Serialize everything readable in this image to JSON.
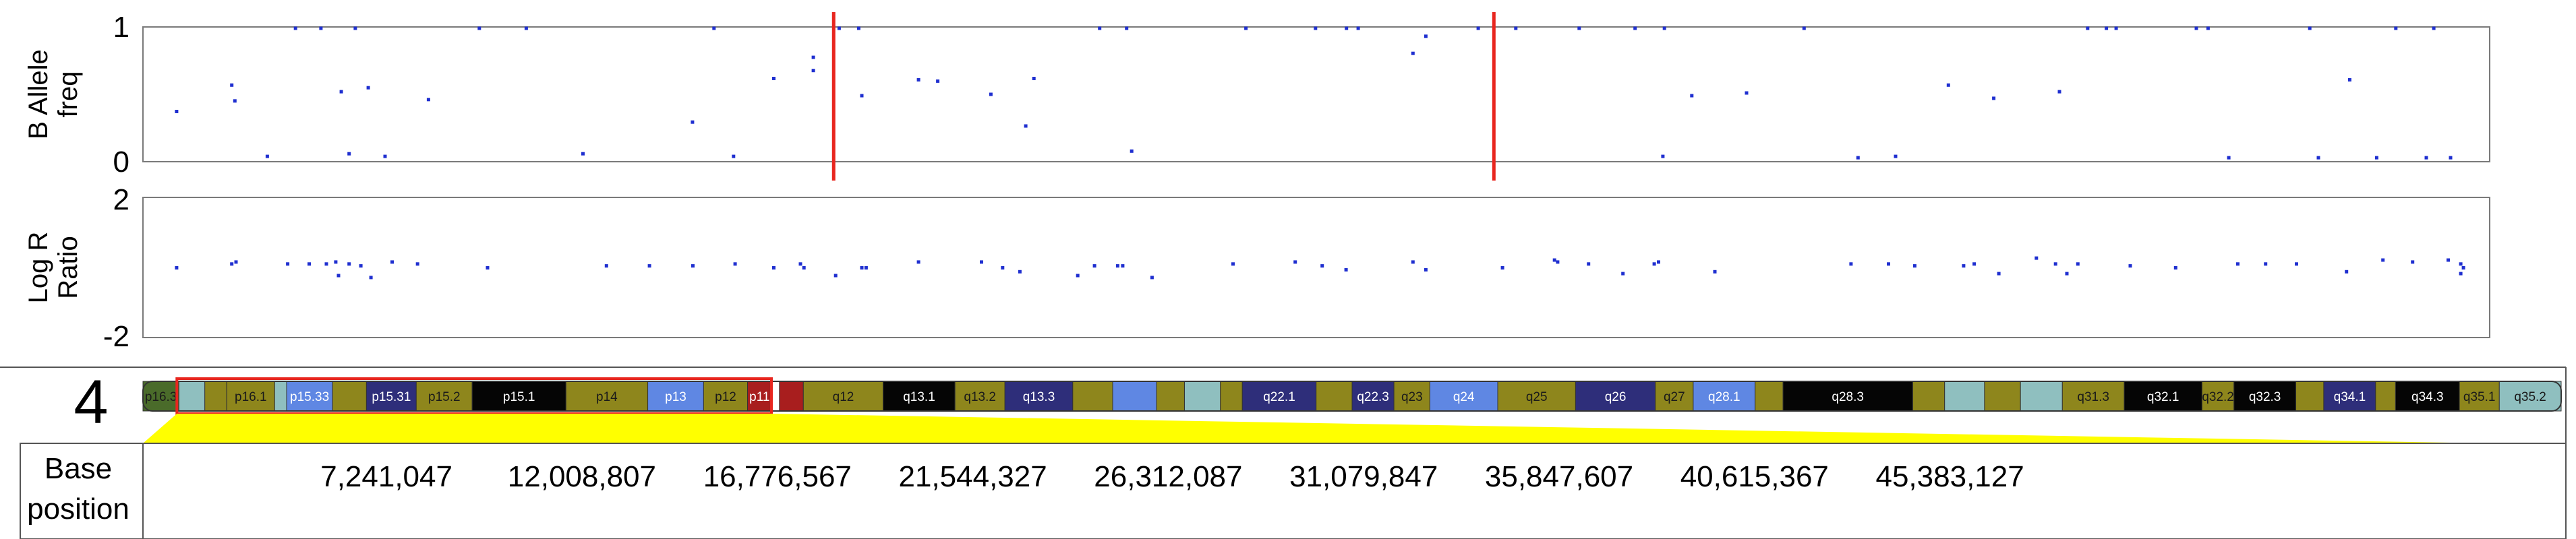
{
  "chart_data": [
    {
      "type": "scatter",
      "ylabel": "B Allele freq",
      "ylim": [
        0,
        1
      ],
      "yticks": [
        "1",
        "0"
      ],
      "point_color": "#1f2fd0",
      "marker_color": "#e8261f",
      "markers_mb": [
        17.66,
        34.54
      ],
      "points": [
        [
          0.86,
          0.37
        ],
        [
          2.27,
          0.57
        ],
        [
          2.35,
          0.45
        ],
        [
          3.18,
          0.03
        ],
        [
          5.07,
          0.52
        ],
        [
          5.27,
          0.05
        ],
        [
          5.76,
          0.55
        ],
        [
          6.19,
          0.03
        ],
        [
          7.3,
          0.46
        ],
        [
          11.25,
          0.05
        ],
        [
          14.05,
          0.29
        ],
        [
          15.1,
          0.03
        ],
        [
          16.13,
          0.62
        ],
        [
          17.14,
          0.68
        ],
        [
          17.14,
          0.78
        ],
        [
          18.38,
          0.49
        ],
        [
          19.83,
          0.61
        ],
        [
          20.32,
          0.6
        ],
        [
          21.68,
          0.5
        ],
        [
          22.57,
          0.26
        ],
        [
          22.78,
          0.62
        ],
        [
          25.28,
          0.07
        ],
        [
          3.9,
          1.0
        ],
        [
          4.55,
          1.0
        ],
        [
          5.43,
          1.0
        ],
        [
          8.6,
          1.0
        ],
        [
          9.8,
          1.0
        ],
        [
          14.6,
          1.0
        ],
        [
          17.8,
          1.0
        ],
        [
          18.3,
          1.0
        ],
        [
          24.46,
          1.0
        ],
        [
          25.15,
          1.0
        ],
        [
          28.2,
          1.0
        ],
        [
          29.98,
          1.0
        ],
        [
          30.77,
          1.0
        ],
        [
          31.07,
          1.0
        ],
        [
          32.47,
          0.81
        ],
        [
          32.8,
          0.94
        ],
        [
          34.14,
          1.0
        ],
        [
          35.1,
          1.0
        ],
        [
          36.72,
          1.0
        ],
        [
          38.15,
          1.0
        ],
        [
          38.86,
          0.03
        ],
        [
          38.9,
          1.0
        ],
        [
          39.6,
          0.49
        ],
        [
          41.0,
          0.51
        ],
        [
          42.47,
          1.0
        ],
        [
          43.85,
          0.02
        ],
        [
          44.81,
          0.03
        ],
        [
          46.16,
          0.57
        ],
        [
          47.32,
          0.47
        ],
        [
          49.0,
          0.52
        ],
        [
          49.72,
          1.0
        ],
        [
          50.2,
          1.0
        ],
        [
          50.45,
          1.0
        ],
        [
          52.5,
          1.0
        ],
        [
          53.33,
          0.02
        ],
        [
          55.4,
          1.0
        ],
        [
          56.42,
          0.61
        ],
        [
          57.11,
          0.02
        ],
        [
          57.6,
          1.0
        ],
        [
          58.38,
          0.02
        ],
        [
          58.57,
          1.0
        ],
        [
          59.0,
          0.02
        ],
        [
          52.8,
          1.0
        ],
        [
          55.62,
          0.02
        ]
      ]
    },
    {
      "type": "scatter",
      "ylabel": "Log R Ratio",
      "ylim": [
        -2,
        2
      ],
      "yticks": [
        "2",
        "-2"
      ],
      "point_color": "#1f2fd0",
      "points": [
        [
          0.86,
          0.0
        ],
        [
          2.27,
          0.2
        ],
        [
          2.38,
          0.3
        ],
        [
          3.7,
          0.2
        ],
        [
          4.25,
          0.2
        ],
        [
          4.69,
          0.2
        ],
        [
          4.93,
          0.3
        ],
        [
          5.0,
          -0.4
        ],
        [
          5.27,
          0.2
        ],
        [
          5.57,
          0.1
        ],
        [
          5.83,
          -0.5
        ],
        [
          6.37,
          0.3
        ],
        [
          7.02,
          0.2
        ],
        [
          8.81,
          0.0
        ],
        [
          11.85,
          0.1
        ],
        [
          12.95,
          0.1
        ],
        [
          14.06,
          0.1
        ],
        [
          15.14,
          0.2
        ],
        [
          16.13,
          0.0
        ],
        [
          16.81,
          0.2
        ],
        [
          16.9,
          0.0
        ],
        [
          17.71,
          -0.4
        ],
        [
          18.38,
          0.0
        ],
        [
          18.49,
          0.0
        ],
        [
          19.83,
          0.3
        ],
        [
          21.44,
          0.3
        ],
        [
          21.98,
          0.0
        ],
        [
          22.42,
          -0.2
        ],
        [
          23.9,
          -0.4
        ],
        [
          24.33,
          0.1
        ],
        [
          24.92,
          0.1
        ],
        [
          25.05,
          0.1
        ],
        [
          25.8,
          -0.5
        ],
        [
          27.87,
          0.2
        ],
        [
          29.46,
          0.3
        ],
        [
          30.15,
          0.1
        ],
        [
          30.76,
          -0.1
        ],
        [
          32.47,
          0.3
        ],
        [
          32.8,
          -0.1
        ],
        [
          34.76,
          0.0
        ],
        [
          36.09,
          0.4
        ],
        [
          36.17,
          0.3
        ],
        [
          36.96,
          0.2
        ],
        [
          37.84,
          -0.3
        ],
        [
          38.64,
          0.2
        ],
        [
          38.75,
          0.3
        ],
        [
          40.19,
          -0.2
        ],
        [
          43.67,
          0.2
        ],
        [
          44.63,
          0.2
        ],
        [
          45.3,
          0.1
        ],
        [
          46.55,
          0.1
        ],
        [
          46.82,
          0.2
        ],
        [
          47.45,
          -0.3
        ],
        [
          48.41,
          0.5
        ],
        [
          48.9,
          0.2
        ],
        [
          49.19,
          -0.3
        ],
        [
          49.47,
          0.2
        ],
        [
          50.81,
          0.1
        ],
        [
          51.97,
          0.0
        ],
        [
          53.56,
          0.2
        ],
        [
          54.27,
          0.2
        ],
        [
          55.06,
          0.2
        ],
        [
          56.34,
          -0.2
        ],
        [
          57.27,
          0.4
        ],
        [
          58.03,
          0.3
        ],
        [
          58.94,
          0.4
        ],
        [
          59.26,
          0.2
        ],
        [
          59.26,
          -0.3
        ],
        [
          59.33,
          0.0
        ]
      ]
    }
  ],
  "ideogram": {
    "chromosome": "4",
    "bands": [
      {
        "label": "p16.3",
        "start": 0.0,
        "end": 0.9,
        "color": "#4a6b2a"
      },
      {
        "label": "",
        "start": 0.9,
        "end": 1.55,
        "color": "#8fbfbf"
      },
      {
        "label": "",
        "start": 1.55,
        "end": 2.1,
        "color": "#8e861c"
      },
      {
        "label": "p16.1",
        "start": 2.1,
        "end": 3.3,
        "color": "#8e861c"
      },
      {
        "label": "",
        "start": 3.3,
        "end": 3.6,
        "color": "#8fbfbf"
      },
      {
        "label": "p15.33",
        "start": 3.6,
        "end": 4.75,
        "color": "#5f87e3"
      },
      {
        "label": "",
        "start": 4.75,
        "end": 5.6,
        "color": "#8e861c"
      },
      {
        "label": "p15.31",
        "start": 5.6,
        "end": 6.85,
        "color": "#2e2e7a"
      },
      {
        "label": "p15.2",
        "start": 6.85,
        "end": 8.25,
        "color": "#8e861c"
      },
      {
        "label": "p15.1",
        "start": 8.25,
        "end": 10.6,
        "color": "#050505"
      },
      {
        "label": "p14",
        "start": 10.6,
        "end": 12.65,
        "color": "#8e861c"
      },
      {
        "label": "p13",
        "start": 12.65,
        "end": 14.05,
        "color": "#5f87e3"
      },
      {
        "label": "p12",
        "start": 14.05,
        "end": 15.15,
        "color": "#8e861c"
      },
      {
        "label": "p11",
        "start": 15.15,
        "end": 15.75,
        "color": "#a81e1e"
      },
      {
        "label": "",
        "start": 15.95,
        "end": 16.55,
        "color": "#a81e1e"
      },
      {
        "label": "q12",
        "start": 16.55,
        "end": 18.55,
        "color": "#8e861c"
      },
      {
        "label": "q13.1",
        "start": 18.55,
        "end": 20.35,
        "color": "#050505"
      },
      {
        "label": "q13.2",
        "start": 20.35,
        "end": 21.6,
        "color": "#8e861c"
      },
      {
        "label": "q13.3",
        "start": 21.6,
        "end": 23.3,
        "color": "#2e2e7a"
      },
      {
        "label": "",
        "start": 23.3,
        "end": 24.3,
        "color": "#8e861c"
      },
      {
        "label": "",
        "start": 24.3,
        "end": 25.4,
        "color": "#5f87e3"
      },
      {
        "label": "",
        "start": 25.4,
        "end": 26.1,
        "color": "#8e861c"
      },
      {
        "label": "",
        "start": 26.1,
        "end": 27.0,
        "color": "#8fbfbf"
      },
      {
        "label": "",
        "start": 27.0,
        "end": 27.55,
        "color": "#8e861c"
      },
      {
        "label": "q22.1",
        "start": 27.55,
        "end": 29.4,
        "color": "#2e2e7a"
      },
      {
        "label": "",
        "start": 29.4,
        "end": 30.3,
        "color": "#8e861c"
      },
      {
        "label": "q22.3",
        "start": 30.3,
        "end": 31.35,
        "color": "#2e2e7a"
      },
      {
        "label": "q23",
        "start": 31.35,
        "end": 32.25,
        "color": "#8e861c"
      },
      {
        "label": "q24",
        "start": 32.25,
        "end": 33.95,
        "color": "#5f87e3"
      },
      {
        "label": "q25",
        "start": 33.95,
        "end": 35.9,
        "color": "#8e861c"
      },
      {
        "label": "q26",
        "start": 35.9,
        "end": 37.9,
        "color": "#2e2e7a"
      },
      {
        "label": "q27",
        "start": 37.9,
        "end": 38.85,
        "color": "#8e861c"
      },
      {
        "label": "q28.1",
        "start": 38.85,
        "end": 40.4,
        "color": "#5f87e3"
      },
      {
        "label": "",
        "start": 40.4,
        "end": 41.1,
        "color": "#8e861c"
      },
      {
        "label": "q28.3",
        "start": 41.1,
        "end": 44.35,
        "color": "#050505"
      },
      {
        "label": "",
        "start": 44.35,
        "end": 45.15,
        "color": "#8e861c"
      },
      {
        "label": "",
        "start": 45.15,
        "end": 46.15,
        "color": "#8fbfbf"
      },
      {
        "label": "",
        "start": 46.15,
        "end": 47.05,
        "color": "#8e861c"
      },
      {
        "label": "",
        "start": 47.05,
        "end": 48.1,
        "color": "#8fbfbf"
      },
      {
        "label": "q31.3",
        "start": 48.1,
        "end": 49.65,
        "color": "#8e861c"
      },
      {
        "label": "q32.1",
        "start": 49.65,
        "end": 51.6,
        "color": "#050505"
      },
      {
        "label": "q32.2",
        "start": 51.6,
        "end": 52.4,
        "color": "#8e861c"
      },
      {
        "label": "q32.3",
        "start": 52.4,
        "end": 53.95,
        "color": "#050505"
      },
      {
        "label": "",
        "start": 53.95,
        "end": 54.65,
        "color": "#8e861c"
      },
      {
        "label": "q34.1",
        "start": 54.65,
        "end": 55.95,
        "color": "#2e2e7a"
      },
      {
        "label": "",
        "start": 55.95,
        "end": 56.45,
        "color": "#8e861c"
      },
      {
        "label": "q34.3",
        "start": 56.45,
        "end": 58.05,
        "color": "#050505"
      },
      {
        "label": "q35.1",
        "start": 58.05,
        "end": 59.05,
        "color": "#8e861c"
      },
      {
        "label": "q35.2",
        "start": 59.05,
        "end": 60.6,
        "color": "#8fbfbf"
      }
    ],
    "selection_box_color": "#e8261f",
    "zoom_fill_color": "#ffff00"
  },
  "base_position": {
    "label_line1": "Base",
    "label_line2": "position",
    "ticks": [
      {
        "mb": 7.241047,
        "label": "7,241,047"
      },
      {
        "mb": 12.008807,
        "label": "12,008,807"
      },
      {
        "mb": 16.776567,
        "label": "16,776,567"
      },
      {
        "mb": 21.544327,
        "label": "21,544,327"
      },
      {
        "mb": 26.312087,
        "label": "26,312,087"
      },
      {
        "mb": 31.079847,
        "label": "31,079,847"
      },
      {
        "mb": 35.847607,
        "label": "35,847,607"
      },
      {
        "mb": 40.615367,
        "label": "40,615,367"
      },
      {
        "mb": 45.383127,
        "label": "45,383,127"
      }
    ]
  }
}
